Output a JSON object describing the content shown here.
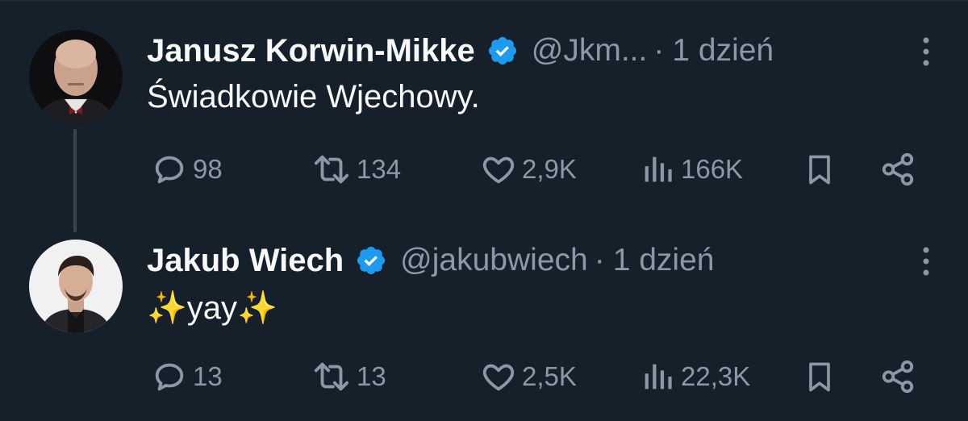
{
  "colors": {
    "background": "#15202b",
    "text_primary": "#f7f9f9",
    "text_secondary": "#8b98a5",
    "verified_badge": "#1d9bf0",
    "thread_line": "#38444d"
  },
  "tweets": [
    {
      "author_name": "Janusz Korwin-Mikke",
      "verified": true,
      "handle": "@Jkm...",
      "separator": "·",
      "time": "1 dzień",
      "text": "Świadkowie Wjechowy.",
      "avatar_icon": "avatar-photo",
      "actions": {
        "replies": "98",
        "retweets": "134",
        "likes": "2,9K",
        "views": "166K"
      }
    },
    {
      "author_name": "Jakub Wiech",
      "verified": true,
      "handle": "@jakubwiech",
      "separator": "·",
      "time": "1 dzień",
      "text": "✨yay✨",
      "avatar_icon": "avatar-photo",
      "actions": {
        "replies": "13",
        "retweets": "13",
        "likes": "2,5K",
        "views": "22,3K"
      }
    }
  ],
  "icons": {
    "reply": "reply-icon",
    "retweet": "retweet-icon",
    "like": "heart-icon",
    "views": "views-icon",
    "bookmark": "bookmark-icon",
    "share": "share-icon",
    "more": "more-icon",
    "verified": "verified-badge-icon"
  }
}
